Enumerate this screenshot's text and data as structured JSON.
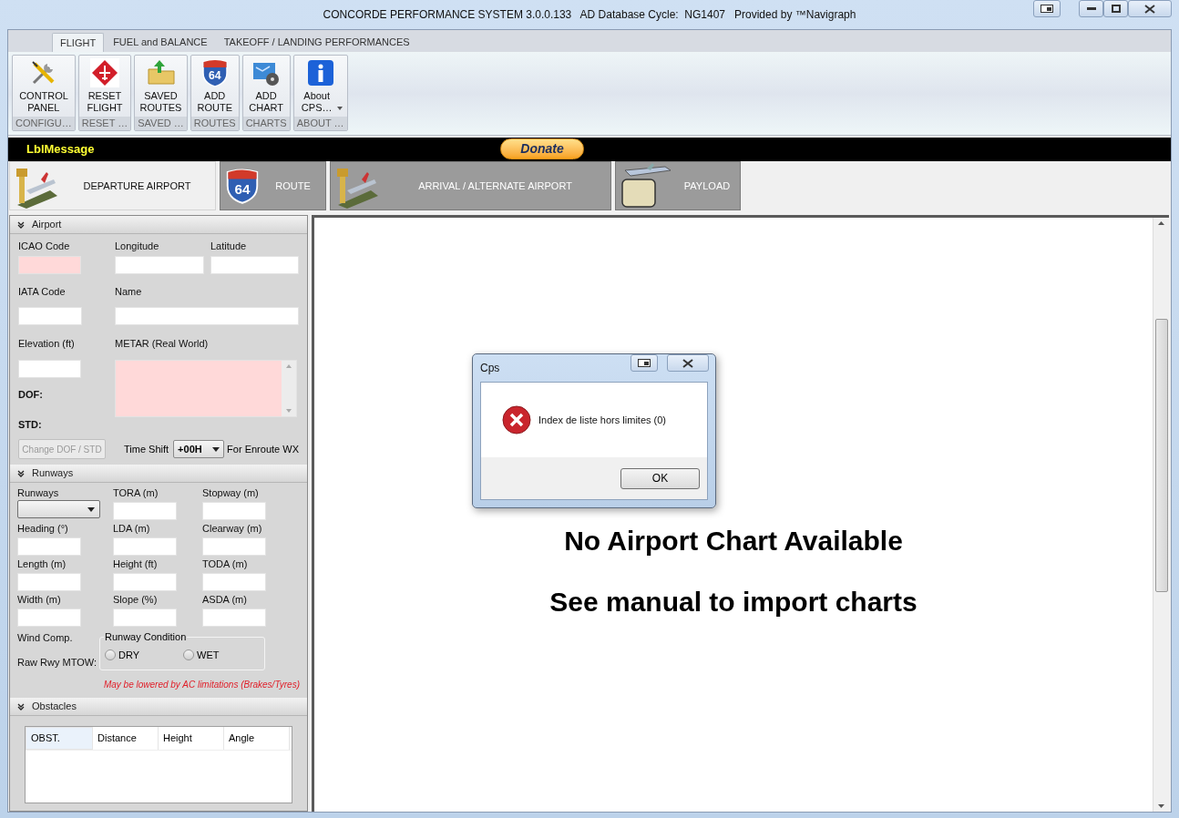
{
  "window": {
    "title": "CONCORDE PERFORMANCE SYSTEM 3.0.0.133   AD Database Cycle:  NG1407   Provided by ™Navigraph"
  },
  "ribbon": {
    "tabs": [
      {
        "label": "FLIGHT",
        "selected": true
      },
      {
        "label": "FUEL and BALANCE",
        "selected": false
      },
      {
        "label": "TAKEOFF / LANDING PERFORMANCES",
        "selected": false
      }
    ],
    "groups": [
      {
        "kind": "tools",
        "caption": "CONTROL PANEL",
        "group": "CONFIGU…",
        "dropdown": false
      },
      {
        "kind": "reset",
        "caption": "RESET FLIGHT",
        "group": "RESET …",
        "dropdown": false
      },
      {
        "kind": "folder",
        "caption": "SAVED ROUTES",
        "group": "SAVED …",
        "dropdown": false
      },
      {
        "kind": "shield",
        "caption": "ADD ROUTE",
        "group": "ROUTES",
        "dropdown": false,
        "shield_text": "64"
      },
      {
        "kind": "chart",
        "caption": "ADD CHART",
        "group": "CHARTS",
        "dropdown": false
      },
      {
        "kind": "info",
        "caption": "About CPS…",
        "group": "ABOUT …",
        "dropdown": true
      }
    ]
  },
  "message_bar": {
    "text": "LblMessage",
    "donate": "Donate"
  },
  "page_tabs": [
    {
      "kind": "tower",
      "label": "DEPARTURE AIRPORT",
      "selected": true
    },
    {
      "kind": "shield",
      "label": "ROUTE",
      "selected": false,
      "shield_text": "64"
    },
    {
      "kind": "tower",
      "label": "ARRIVAL / ALTERNATE AIRPORT",
      "selected": false
    },
    {
      "kind": "payload",
      "label": "PAYLOAD",
      "selected": false
    }
  ],
  "airport": {
    "title": "Airport",
    "icao": {
      "label": "ICAO Code",
      "highlighted": true
    },
    "longitude": {
      "label": "Longitude",
      "highlighted": false
    },
    "latitude": {
      "label": "Latitude",
      "highlighted": false
    },
    "iata": {
      "label": "IATA Code",
      "highlighted": false
    },
    "name": {
      "label": "Name",
      "highlighted": false
    },
    "elevation": {
      "label": "Elevation (ft)",
      "highlighted": false
    },
    "metar": {
      "label": "METAR (Real World)",
      "highlighted": true
    },
    "dof": "DOF:",
    "std": "STD:",
    "change_button": {
      "label": "Change DOF / STD",
      "disabled": true
    },
    "time_shift": {
      "label": "Time Shift",
      "value": "+00H",
      "suffix": "For Enroute WX"
    }
  },
  "runways": {
    "title": "Runways",
    "select_label": "Runways",
    "fields": [
      {
        "label": "TORA (m)"
      },
      {
        "label": "Stopway (m)"
      },
      {
        "label": "Heading (°)"
      },
      {
        "label": "LDA (m)"
      },
      {
        "label": "Clearway (m)"
      },
      {
        "label": "Length (m)"
      },
      {
        "label": "Height (ft)"
      },
      {
        "label": "TODA (m)"
      },
      {
        "label": "Width (m)"
      },
      {
        "label": "Slope (%)"
      },
      {
        "label": "ASDA (m)"
      }
    ],
    "wind_comp": "Wind Comp.",
    "mtow": "Raw Rwy MTOW:",
    "condition": {
      "title": "Runway Condition",
      "options": [
        {
          "label": "DRY",
          "selected": false
        },
        {
          "label": "WET",
          "selected": false
        }
      ]
    },
    "note": "May be lowered by AC limitations (Brakes/Tyres)"
  },
  "obstacles": {
    "title": "Obstacles",
    "columns": [
      "OBST.",
      "Distance",
      "Height",
      "Angle"
    ]
  },
  "chart_area": {
    "lines": [
      "No Airport Chart Available",
      "See manual to import charts"
    ]
  },
  "dialog": {
    "title": "Cps",
    "message": "Index de liste hors limites (0)",
    "button": "OK"
  }
}
